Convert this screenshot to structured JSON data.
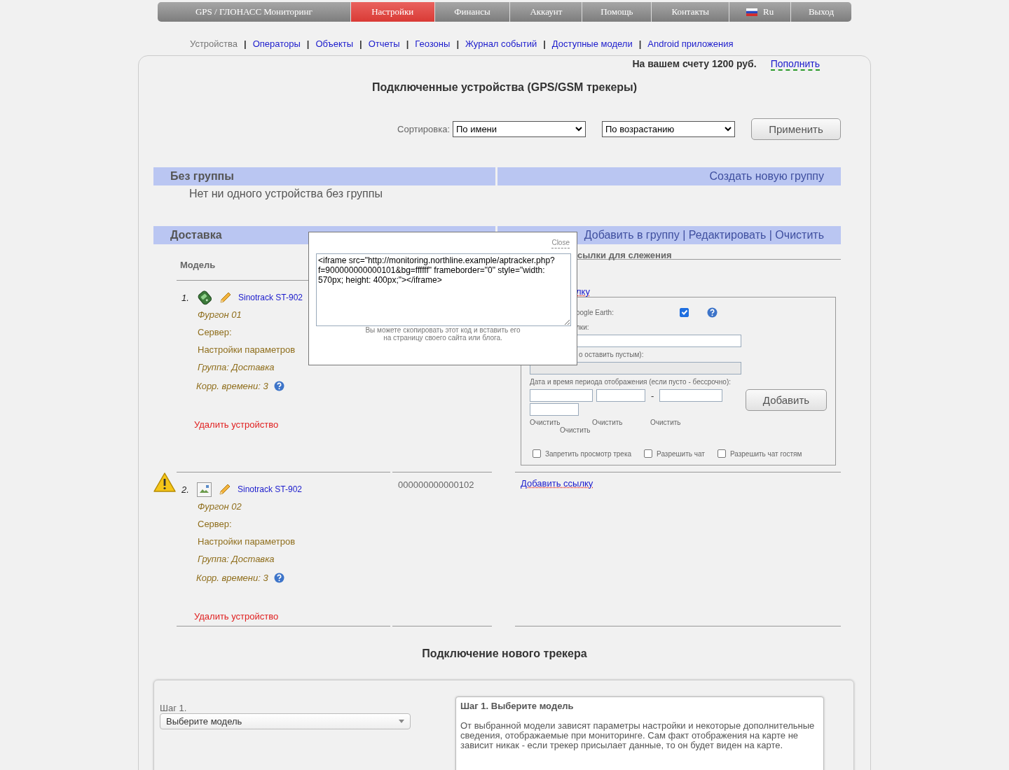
{
  "nav": [
    {
      "label": "GPS / ГЛОНАСС Мониторинг",
      "selected": false,
      "kind": "text"
    },
    {
      "label": "Настройки",
      "selected": true,
      "kind": "text"
    },
    {
      "label": "Финансы",
      "selected": false,
      "kind": "text"
    },
    {
      "label": "Аккаунт",
      "selected": false,
      "kind": "text"
    },
    {
      "label": "Помощь",
      "selected": false,
      "kind": "text"
    },
    {
      "label": "Контакты",
      "selected": false,
      "kind": "text"
    },
    {
      "label": "Ru",
      "selected": false,
      "kind": "lang"
    },
    {
      "label": "Выход",
      "selected": false,
      "kind": "text"
    }
  ],
  "subnav": {
    "separator": "|",
    "items": [
      {
        "label": "Устройства",
        "selected": true
      },
      {
        "label": "Операторы",
        "selected": false
      },
      {
        "label": "Объекты",
        "selected": false
      },
      {
        "label": "Отчеты",
        "selected": false
      },
      {
        "label": "Геозоны",
        "selected": false
      },
      {
        "label": "Журнал событий",
        "selected": false
      },
      {
        "label": "Доступные модели",
        "selected": false
      },
      {
        "label": "Android приложения",
        "selected": false
      }
    ]
  },
  "balance": {
    "text": "На вашем счету 1200 руб.",
    "link": "Пополнить"
  },
  "title": "Подключенные устройства (GPS/GSM трекеры)",
  "sort": {
    "label": "Сортировка:",
    "field": "По имени",
    "order": "По возрастанию",
    "button": "Применить"
  },
  "groups": [
    {
      "name": "Без группы",
      "actions": "Создать новую группу",
      "empty_text": "Нет ни одного устройства без группы"
    },
    {
      "name": "Доставка",
      "actions": "Добавить в группу | Редактировать | Очистить",
      "columns": [
        "Модель",
        "сылки для слежения"
      ],
      "devices": [
        {
          "number": "1.",
          "warning": false,
          "kind": "device",
          "name": "Sinotrack ST-902",
          "label": "Фургон 01",
          "server": "Сервер:",
          "settings": "Настройки параметров",
          "group": "Группа: Доставка",
          "time_offset": "Корр. времени: 3",
          "delete": "Удалить устройство",
          "add_link": "лку",
          "form": {
            "google_earth_label": "oogle Earth:",
            "google_earth": true,
            "name_label": "лки:",
            "password_label": "о оставить пустым):",
            "period_label": "Дата и время периода отображения (если пусто - бессрочно):",
            "period_separator": "-",
            "clear": [
              "Очистить",
              "Очистить",
              "Очистить",
              "Очистить"
            ],
            "add_button": "Добавить",
            "options": [
              {
                "label": "Запретить просмотр трека",
                "checked": false
              },
              {
                "label": "Разрешить чат",
                "checked": false
              },
              {
                "label": "Разрешить чат гостям",
                "checked": false
              }
            ]
          }
        },
        {
          "number": "2.",
          "warning": true,
          "kind": "broken",
          "name": "Sinotrack ST-902",
          "label": "Фургон 02",
          "server": "Сервер:",
          "settings": "Настройки параметров",
          "group": "Группа: Доставка",
          "time_offset": "Корр. времени: 3",
          "delete": "Удалить устройство",
          "imei": "000000000000102",
          "add_link": "Добавить ссылку"
        }
      ]
    }
  ],
  "modal": {
    "close": "Close",
    "code": "<iframe src=\"http://monitoring.northline.example/aptracker.php?f=900000000000101&bg=ffffff\" frameborder=\"0\" style=\"width: 570px; height: 400px;\"></iframe>",
    "hint": "Вы можете скопировать этот код и вставить его\nна страницу своего сайта или блога."
  },
  "new_tracker": {
    "title": "Подключение нового трекера",
    "step_label": "Шаг 1.",
    "model_select": "Выберите модель",
    "info_title": "Шаг 1. Выберите модель",
    "info_text": "От выбранной модели зависят параметры настройки и некоторые дополнительные сведения, отображаемые при мониторинге. Сам факт отображения на карте не зависит никак - если трекер присылает данные, то он будет виден на карте."
  }
}
